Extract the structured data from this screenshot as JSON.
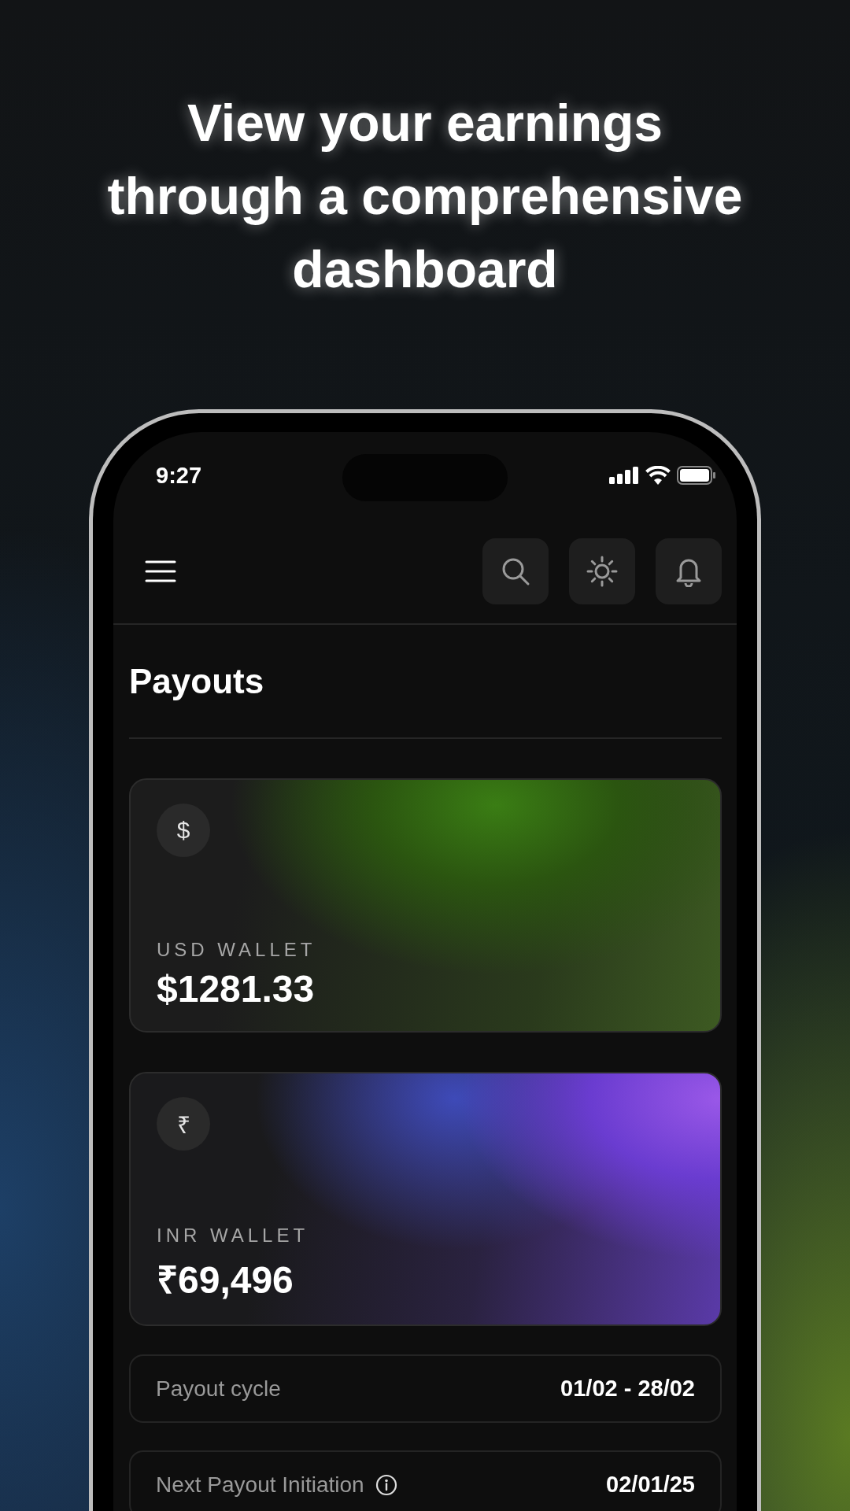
{
  "headline": "View your earnings through a comprehensive dashboard",
  "status_bar": {
    "time": "9:27"
  },
  "page_title": "Payouts",
  "wallets": [
    {
      "kind": "usd",
      "symbol": "$",
      "label": "USD WALLET",
      "amount": "$1281.33"
    },
    {
      "kind": "inr",
      "symbol": "₹",
      "label": "INR WALLET",
      "amount": "₹69,496"
    }
  ],
  "details": [
    {
      "label": "Payout cycle",
      "value": "01/02 - 28/02",
      "info": false
    },
    {
      "label": "Next Payout Initiation",
      "value": "02/01/25",
      "info": true
    }
  ]
}
